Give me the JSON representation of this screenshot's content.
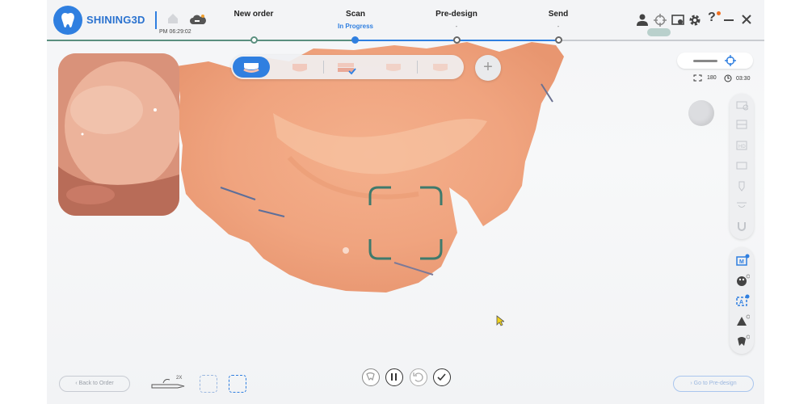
{
  "app": {
    "brand": "SHINING3D",
    "datetime": "PM 06:29:02"
  },
  "steps": [
    {
      "label": "New order",
      "status": ""
    },
    {
      "label": "Scan",
      "status": "In Progress"
    },
    {
      "label": "Pre-design",
      "status": "-"
    },
    {
      "label": "Send",
      "status": "-"
    }
  ],
  "header_icons": [
    "user-icon",
    "target-icon",
    "screen-record-icon",
    "gear-icon",
    "help-icon",
    "minimize-icon",
    "close-icon"
  ],
  "scan_modes": [
    "upper-jaw-icon",
    "lower-jaw-icon",
    "bite-icon",
    "upper-prep-icon",
    "lower-prep-icon"
  ],
  "add_label": "+",
  "stats": {
    "frames": "180",
    "time": "03:30"
  },
  "bottom": {
    "back_label": "Back to Order",
    "next_label": "Go to Pre-design",
    "zoom_label": "2X"
  },
  "colors": {
    "accent": "#2f7fe0",
    "focus_frame": "#3f7a6c",
    "tissue": "#f0a47f"
  }
}
